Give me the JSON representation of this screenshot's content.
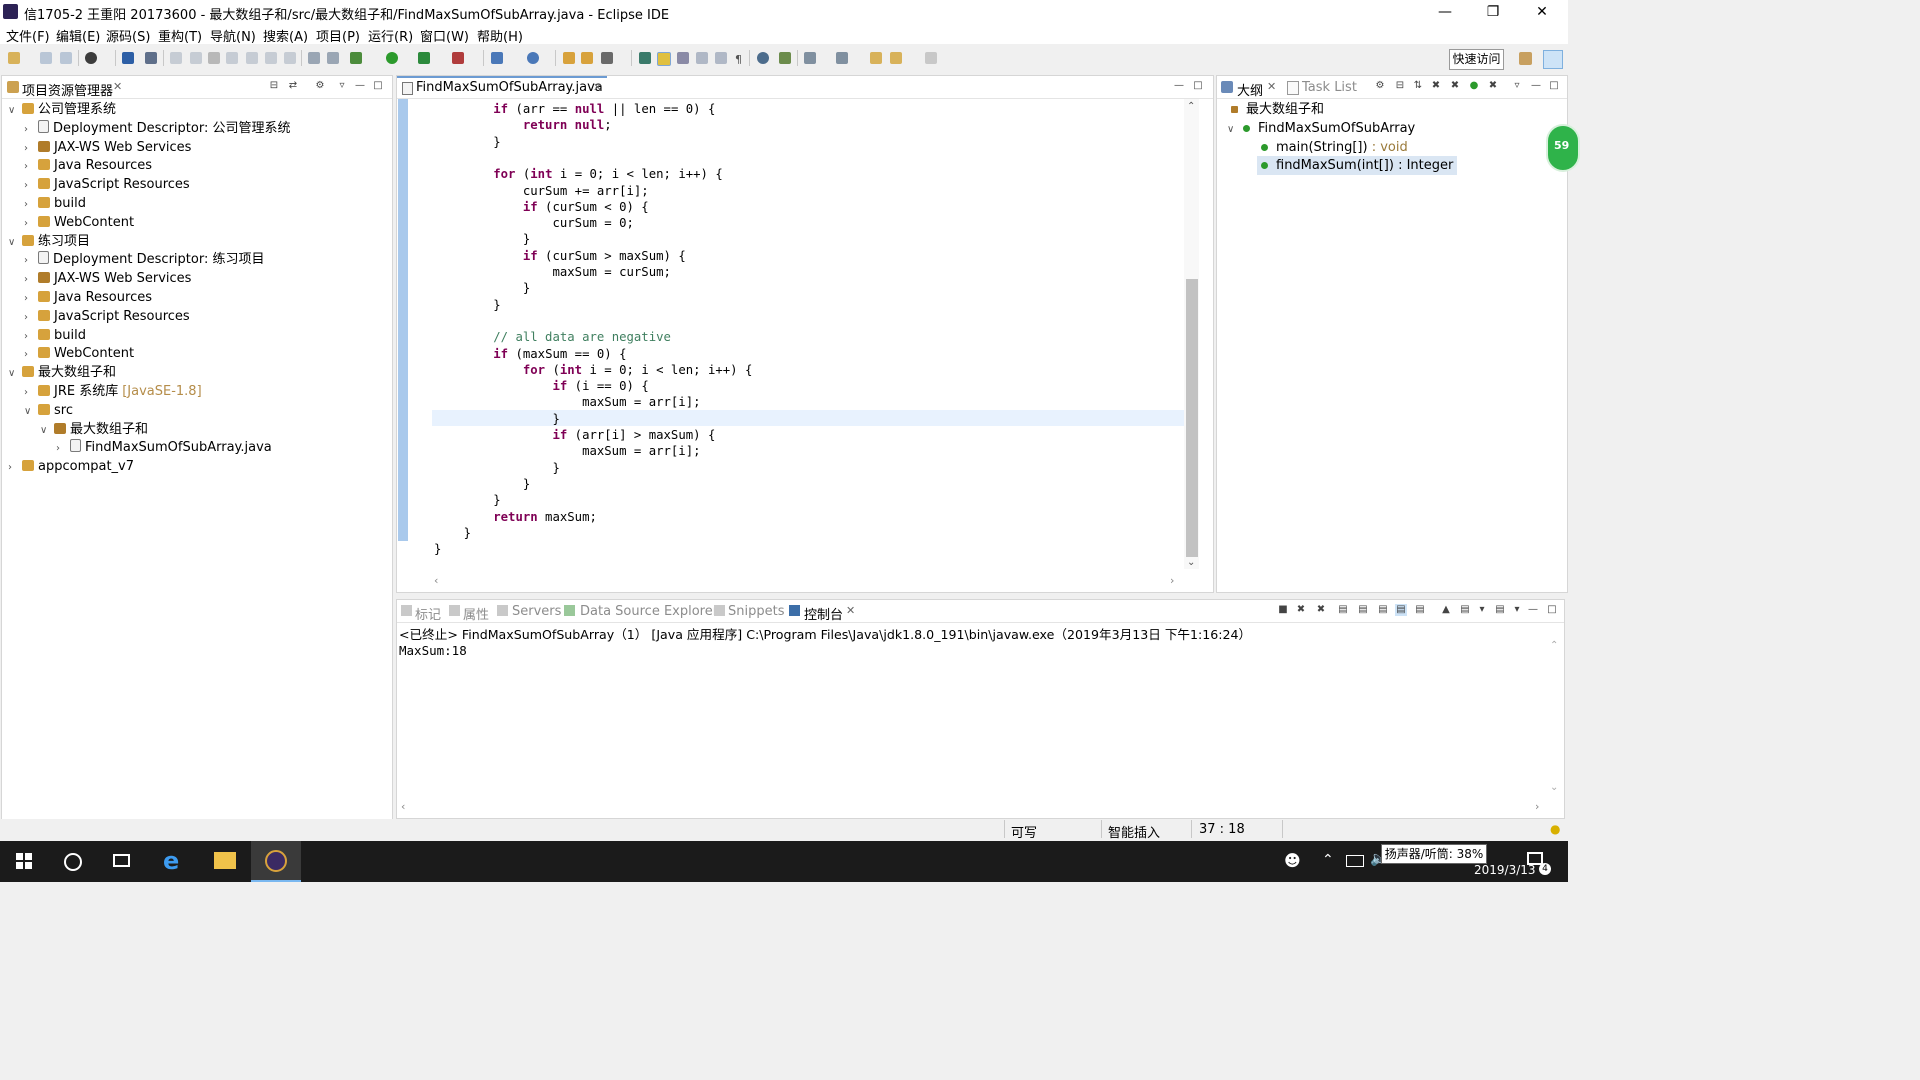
{
  "window": {
    "title": "信1705-2 王重阳 20173600 - 最大数组子和/src/最大数组子和/FindMaxSumOfSubArray.java - Eclipse IDE",
    "minimize_icon": "minimize-icon",
    "restore_icon": "restore-icon",
    "close_icon": "close-icon"
  },
  "menu": [
    "文件(F)",
    "编辑(E)",
    "源码(S)",
    "重构(T)",
    "导航(N)",
    "搜索(A)",
    "项目(P)",
    "运行(R)",
    "窗口(W)",
    "帮助(H)"
  ],
  "toolbar": {
    "quick_access": "快速访问"
  },
  "project_explorer": {
    "tab_label": "项目资源管理器",
    "items": [
      {
        "label": "公司管理系统",
        "level": 0,
        "expanded": true,
        "icon": "project-icon"
      },
      {
        "label": "Deployment Descriptor: 公司管理系统",
        "level": 1,
        "icon": "descriptor-icon"
      },
      {
        "label": "JAX-WS Web Services",
        "level": 1,
        "icon": "webservice-icon"
      },
      {
        "label": "Java Resources",
        "level": 1,
        "icon": "java-resources-icon"
      },
      {
        "label": "JavaScript Resources",
        "level": 1,
        "icon": "js-resources-icon"
      },
      {
        "label": "build",
        "level": 1,
        "icon": "folder-icon"
      },
      {
        "label": "WebContent",
        "level": 1,
        "icon": "folder-icon"
      },
      {
        "label": "练习项目",
        "level": 0,
        "expanded": true,
        "icon": "project-icon"
      },
      {
        "label": "Deployment Descriptor: 练习项目",
        "level": 1,
        "icon": "descriptor-icon"
      },
      {
        "label": "JAX-WS Web Services",
        "level": 1,
        "icon": "webservice-icon"
      },
      {
        "label": "Java Resources",
        "level": 1,
        "icon": "java-resources-icon"
      },
      {
        "label": "JavaScript Resources",
        "level": 1,
        "icon": "js-resources-icon"
      },
      {
        "label": "build",
        "level": 1,
        "icon": "folder-icon"
      },
      {
        "label": "WebContent",
        "level": 1,
        "icon": "folder-icon"
      },
      {
        "label": "最大数组子和",
        "level": 0,
        "expanded": true,
        "icon": "project-icon"
      },
      {
        "label": "JRE 系统库",
        "suffix": "[JavaSE-1.8]",
        "level": 1,
        "icon": "library-icon"
      },
      {
        "label": "src",
        "level": 1,
        "expanded": true,
        "icon": "source-folder-icon"
      },
      {
        "label": "最大数组子和",
        "level": 2,
        "expanded": true,
        "icon": "package-icon"
      },
      {
        "label": "FindMaxSumOfSubArray.java",
        "level": 3,
        "icon": "java-file-icon"
      },
      {
        "label": "appcompat_v7",
        "level": 0,
        "icon": "project-icon"
      }
    ]
  },
  "editor": {
    "tab_label": "FindMaxSumOfSubArray.java",
    "cursor_line_index": 19
  },
  "outline": {
    "tab_label": "大纲",
    "task_list_label": "Task List",
    "items": [
      {
        "label": "最大数组子和",
        "level": 0,
        "icon": "package-icon"
      },
      {
        "label": "FindMaxSumOfSubArray",
        "level": 0,
        "icon": "class-icon"
      },
      {
        "label": "main(String[])",
        "type": " : void",
        "level": 1,
        "icon": "public-static-method-icon"
      },
      {
        "label": "findMaxSum(int[]) : Integer",
        "level": 1,
        "icon": "public-method-icon",
        "selected": true
      }
    ],
    "badge": "59"
  },
  "bottom_tabs": [
    "标记",
    "属性",
    "Servers",
    "Data Source Explorer",
    "Snippets",
    "控制台"
  ],
  "console": {
    "header": "<已终止> FindMaxSumOfSubArray（1）  [Java 应用程序] C:\\Program Files\\Java\\jdk1.8.0_191\\bin\\javaw.exe（2019年3月13日 下午1:16:24）",
    "output": "MaxSum:18"
  },
  "status_bar": {
    "writable": "可写",
    "insert_mode": "智能插入",
    "position": "37 : 18"
  },
  "taskbar": {
    "tooltip": "扬声器/听筒: 38%",
    "date": "2019/3/13",
    "notification_count": "4"
  },
  "colors": {
    "keyword": "#7f0055",
    "comment": "#3f7f5f",
    "selection": "#dae6f3",
    "current_line": "#e8f2fe",
    "accent": "#1a73b8"
  }
}
